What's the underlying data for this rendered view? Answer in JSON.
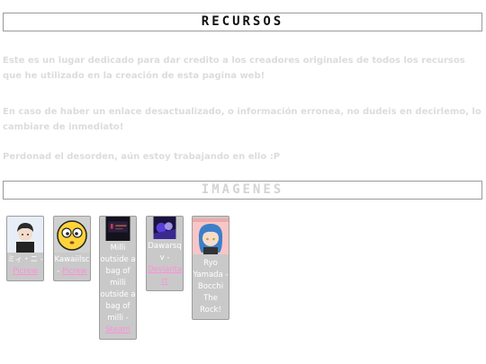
{
  "sections": {
    "resources_title": "RECURSOS",
    "images_title": "IMAGENES"
  },
  "intro": {
    "p1": "Este es un lugar dedicado para dar credito a los creadores originales de todos los recursos que he utilizado en la creación de esta pagina web!",
    "p2": "En caso de haber un enlace desactualizado, o información erronea, no dudeis en decirlemo, lo cambiare de inmediato!",
    "p3": "Perdonad el desorden, aún estoy trabajando en ello :P"
  },
  "cards": [
    {
      "text": "ミィ・ニ - ",
      "link": "Picrew"
    },
    {
      "text": "Kawaiilsc - ",
      "link": "Picrew"
    },
    {
      "text": "Milli outside a bag of milli outside a bag of milli - ",
      "link": "Steam"
    },
    {
      "text": "Dawarsqv - ",
      "link": "Deviantart"
    },
    {
      "text": "Ryo Yamada - Bocchi The Rock!",
      "link": ""
    }
  ]
}
